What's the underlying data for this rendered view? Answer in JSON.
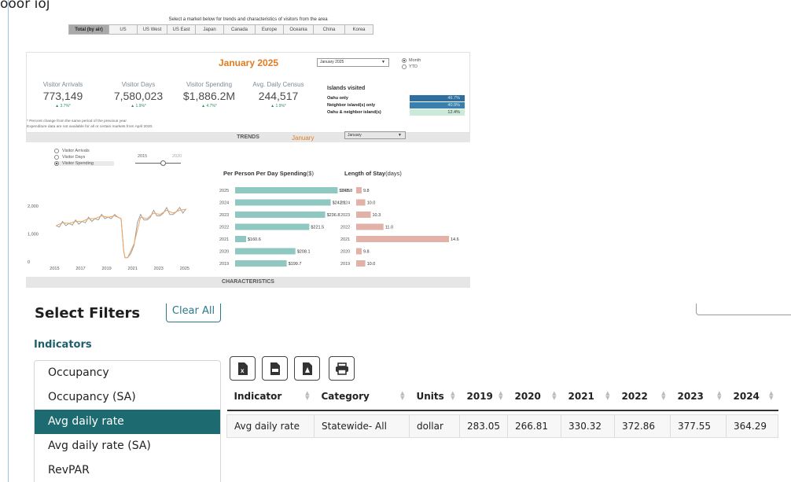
{
  "page": {
    "top_fragment": "ooor ioj"
  },
  "dashboard": {
    "hint": "Select a market below for trends and characteristics of visitors from the area",
    "market_tabs": [
      {
        "label": "Total (by air)",
        "active": true
      },
      {
        "label": "US",
        "active": false
      },
      {
        "label": "US West",
        "active": false
      },
      {
        "label": "US East",
        "active": false
      },
      {
        "label": "Japan",
        "active": false
      },
      {
        "label": "Canada",
        "active": false
      },
      {
        "label": "Europe",
        "active": false
      },
      {
        "label": "Oceania",
        "active": false
      },
      {
        "label": "China",
        "active": false
      },
      {
        "label": "Korea",
        "active": false
      }
    ],
    "month_title": "January 2025",
    "month_select": "January 2025",
    "period_options": [
      {
        "label": "Month",
        "selected": true
      },
      {
        "label": "YTD",
        "selected": false
      }
    ],
    "kpis": [
      {
        "label": "Visitor Arrivals",
        "value": "773,149",
        "change": "▲ 3.7%*"
      },
      {
        "label": "Visitor Days",
        "value": "7,580,023",
        "change": "▲ 1.9%*"
      },
      {
        "label": "Visitor Spending",
        "value": "$1,886.2M",
        "change": "▲ 4.7%*"
      },
      {
        "label": "Avg. Daily Census",
        "value": "244,517",
        "change": "▲ 1.9%*"
      }
    ],
    "islands": {
      "title": "Islands visited",
      "rows": [
        {
          "name": "Oahu only",
          "pct": "46.7%",
          "bg": "#2f6f9f",
          "fg": "#cfe0ee"
        },
        {
          "name": "Neighbor island(s) only",
          "pct": "40.9%",
          "bg": "#3b80ad",
          "fg": "#d6e6f1"
        },
        {
          "name": "Oahu & neighbor island(s)",
          "pct": "12.4%",
          "bg": "#c9ead9",
          "fg": "#333333"
        }
      ]
    },
    "footnotes": [
      "* Percent change from the same period of the previous year",
      "Expenditure data are not available for all or certain markets from April 2020."
    ],
    "trends_label": "TRENDS",
    "trend_options": [
      {
        "label": "Visitor Arrivals",
        "selected": false
      },
      {
        "label": "Visitor Days",
        "selected": false
      },
      {
        "label": "Visitor Spending",
        "selected": true
      }
    ],
    "year_range": {
      "start": "2015",
      "end": "2020"
    },
    "trend_month": "January",
    "trend_select": "January",
    "characteristics_label": "CHARACTERISTICS"
  },
  "chart_data": [
    {
      "type": "line",
      "title": "",
      "xlabel": "",
      "ylabel": "",
      "x_ticks": [
        "2015",
        "2017",
        "2019",
        "2021",
        "2023",
        "2025"
      ],
      "y_ticks": [
        "0",
        "1,000",
        "2,000"
      ],
      "ylim": [
        0,
        2200
      ],
      "series": [
        {
          "color": "#9e9e9e",
          "x": [
            2015.0,
            2015.25,
            2015.5,
            2015.75,
            2016.0,
            2016.25,
            2016.5,
            2016.75,
            2017.0,
            2017.25,
            2017.5,
            2017.75,
            2018.0,
            2018.25,
            2018.5,
            2018.75,
            2019.0,
            2019.25,
            2019.5,
            2019.75,
            2020.0,
            2020.2,
            2020.3,
            2020.5,
            2020.75,
            2021.0,
            2021.25,
            2021.5,
            2021.75,
            2022.0,
            2022.25,
            2022.5,
            2022.75,
            2023.0,
            2023.25,
            2023.5,
            2023.75,
            2024.0,
            2024.25,
            2024.5,
            2024.75,
            2025.0
          ],
          "values": [
            1300,
            1250,
            1450,
            1300,
            1380,
            1320,
            1500,
            1350,
            1450,
            1400,
            1600,
            1450,
            1550,
            1500,
            1700,
            1550,
            1600,
            1550,
            1700,
            1600,
            1550,
            400,
            150,
            150,
            300,
            600,
            1400,
            1700,
            1500,
            1500,
            1600,
            1850,
            1650,
            1650,
            1750,
            1950,
            1700,
            1700,
            1800,
            1950,
            1750,
            1900
          ]
        },
        {
          "color": "#f0a35e",
          "x": [
            2015.0,
            2015.5,
            2016.0,
            2016.5,
            2017.0,
            2017.5,
            2018.0,
            2018.5,
            2019.0,
            2019.5,
            2020.0,
            2020.2,
            2020.3,
            2020.5,
            2021.0,
            2021.5,
            2022.0,
            2022.5,
            2023.0,
            2023.5,
            2024.0,
            2024.5,
            2025.0
          ],
          "values": [
            1300,
            1400,
            1380,
            1450,
            1450,
            1550,
            1550,
            1650,
            1600,
            1650,
            1550,
            400,
            150,
            150,
            650,
            1600,
            1550,
            1750,
            1700,
            1850,
            1750,
            1850,
            1880
          ]
        }
      ]
    },
    {
      "type": "bar",
      "title": "Per Person Per Day Spending",
      "unit": "($)",
      "categories": [
        "2025",
        "2024",
        "2023",
        "2022",
        "2021",
        "2020",
        "2019"
      ],
      "values": [
        248.8,
        242.1,
        236.8,
        221.5,
        160.6,
        208.1,
        199.7
      ],
      "labels": [
        "$248.8",
        "$242.1",
        "$236.8",
        "$221.5",
        "$160.6",
        "$208.1",
        "$199.7"
      ],
      "color": "#8fc8c0",
      "xlim": [
        150,
        250
      ]
    },
    {
      "type": "bar",
      "title": "Length of Stay",
      "unit": "(days)",
      "categories": [
        "2025",
        "2024",
        "2023",
        "2022",
        "2021",
        "2020",
        "2019"
      ],
      "values": [
        9.8,
        10.0,
        10.3,
        11.0,
        14.6,
        9.8,
        10.0
      ],
      "labels": [
        "9.8",
        "10.0",
        "10.3",
        "11.0",
        "14.6",
        "9.8",
        "10.0"
      ],
      "color": "#e2b1a7",
      "xlim": [
        9.5,
        14.6
      ]
    }
  ],
  "filters": {
    "title": "Select Filters",
    "clear_label": "Clear All",
    "indicators_label": "Indicators",
    "indicator_items": [
      {
        "label": "Occupancy",
        "active": false
      },
      {
        "label": "Occupancy (SA)",
        "active": false
      },
      {
        "label": "Avg daily rate",
        "active": true
      },
      {
        "label": "Avg daily rate (SA)",
        "active": false
      },
      {
        "label": "RevPAR",
        "active": false
      }
    ]
  },
  "export_buttons": [
    {
      "icon": "excel-icon",
      "glyph": "x"
    },
    {
      "icon": "csv-icon",
      "glyph": "csv"
    },
    {
      "icon": "pdf-icon",
      "glyph": "pdf"
    },
    {
      "icon": "print-icon",
      "glyph": ""
    }
  ],
  "table": {
    "columns": [
      "Indicator",
      "Category",
      "Units",
      "2019",
      "2020",
      "2021",
      "2022",
      "2023",
      "2024"
    ],
    "rows": [
      [
        "Avg daily rate",
        "Statewide- All",
        "dollar",
        "283.05",
        "266.81",
        "330.32",
        "372.86",
        "377.55",
        "364.29"
      ]
    ]
  }
}
